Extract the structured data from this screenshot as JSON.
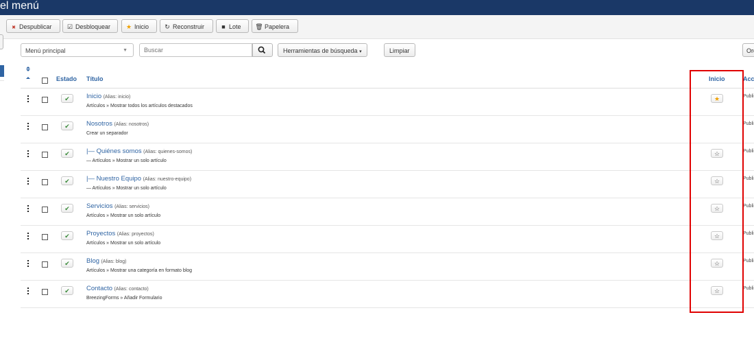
{
  "header": {
    "title": "el menú"
  },
  "toolbar": [
    {
      "id": "unpublish",
      "label": "Despublicar",
      "icon": "circle-x-icon",
      "color": "#c0392b"
    },
    {
      "id": "unlock",
      "label": "Desbloquear",
      "icon": "checkbox-icon",
      "color": "#333333"
    },
    {
      "id": "home",
      "label": "Inicio",
      "icon": "star-icon",
      "color": "#f0a000"
    },
    {
      "id": "rebuild",
      "label": "Reconstruir",
      "icon": "refresh-icon",
      "color": "#333333"
    },
    {
      "id": "batch",
      "label": "Lote",
      "icon": "square-icon",
      "color": "#333333"
    },
    {
      "id": "trash",
      "label": "Papelera",
      "icon": "trash-icon",
      "color": "#333333"
    }
  ],
  "filters": {
    "menu_select": "Menú principal",
    "search_placeholder": "Buscar",
    "search_tools_label": "Herramientas de búsqueda",
    "clear_label": "Limpiar",
    "order_label": "Ord"
  },
  "table": {
    "headers": {
      "status": "Estado",
      "title": "Título",
      "home": "Inicio",
      "access": "Acc"
    },
    "rows": [
      {
        "title": "Inicio",
        "alias": "(Alias: inicio)",
        "type": "Artículos » Mostrar todos los artículos destacados",
        "home": true,
        "access": "Publi"
      },
      {
        "title": "Nosotros",
        "alias": "(Alias: nosotros)",
        "type": "Crear un separador",
        "home": null,
        "access": "Publi"
      },
      {
        "title": "|— Quiénes somos",
        "alias": "(Alias: quienes-somos)",
        "type": "— Artículos » Mostrar un solo artículo",
        "home": false,
        "access": "Publi"
      },
      {
        "title": "|— Nuestro Equipo",
        "alias": "(Alias: nuestro-equipo)",
        "type": "— Artículos » Mostrar un solo artículo",
        "home": false,
        "access": "Publi"
      },
      {
        "title": "Servicios",
        "alias": "(Alias: servicios)",
        "type": "Artículos » Mostrar un solo artículo",
        "home": false,
        "access": "Publi"
      },
      {
        "title": "Proyectos",
        "alias": "(Alias: proyectos)",
        "type": "Artículos » Mostrar un solo artículo",
        "home": false,
        "access": "Publi"
      },
      {
        "title": "Blog",
        "alias": "(Alias: blog)",
        "type": "Artículos » Mostrar una categoría en formato blog",
        "home": false,
        "access": "Publi"
      },
      {
        "title": "Contacto",
        "alias": "(Alias: contacto)",
        "type": "BreezingForms » Añadir Formulario",
        "home": false,
        "access": "Publi"
      }
    ]
  },
  "colors": {
    "brand": "#1a3867",
    "link": "#2f64a3",
    "highlight": "#e00000",
    "star_on": "#f0a000",
    "check": "#3a8a3a"
  }
}
